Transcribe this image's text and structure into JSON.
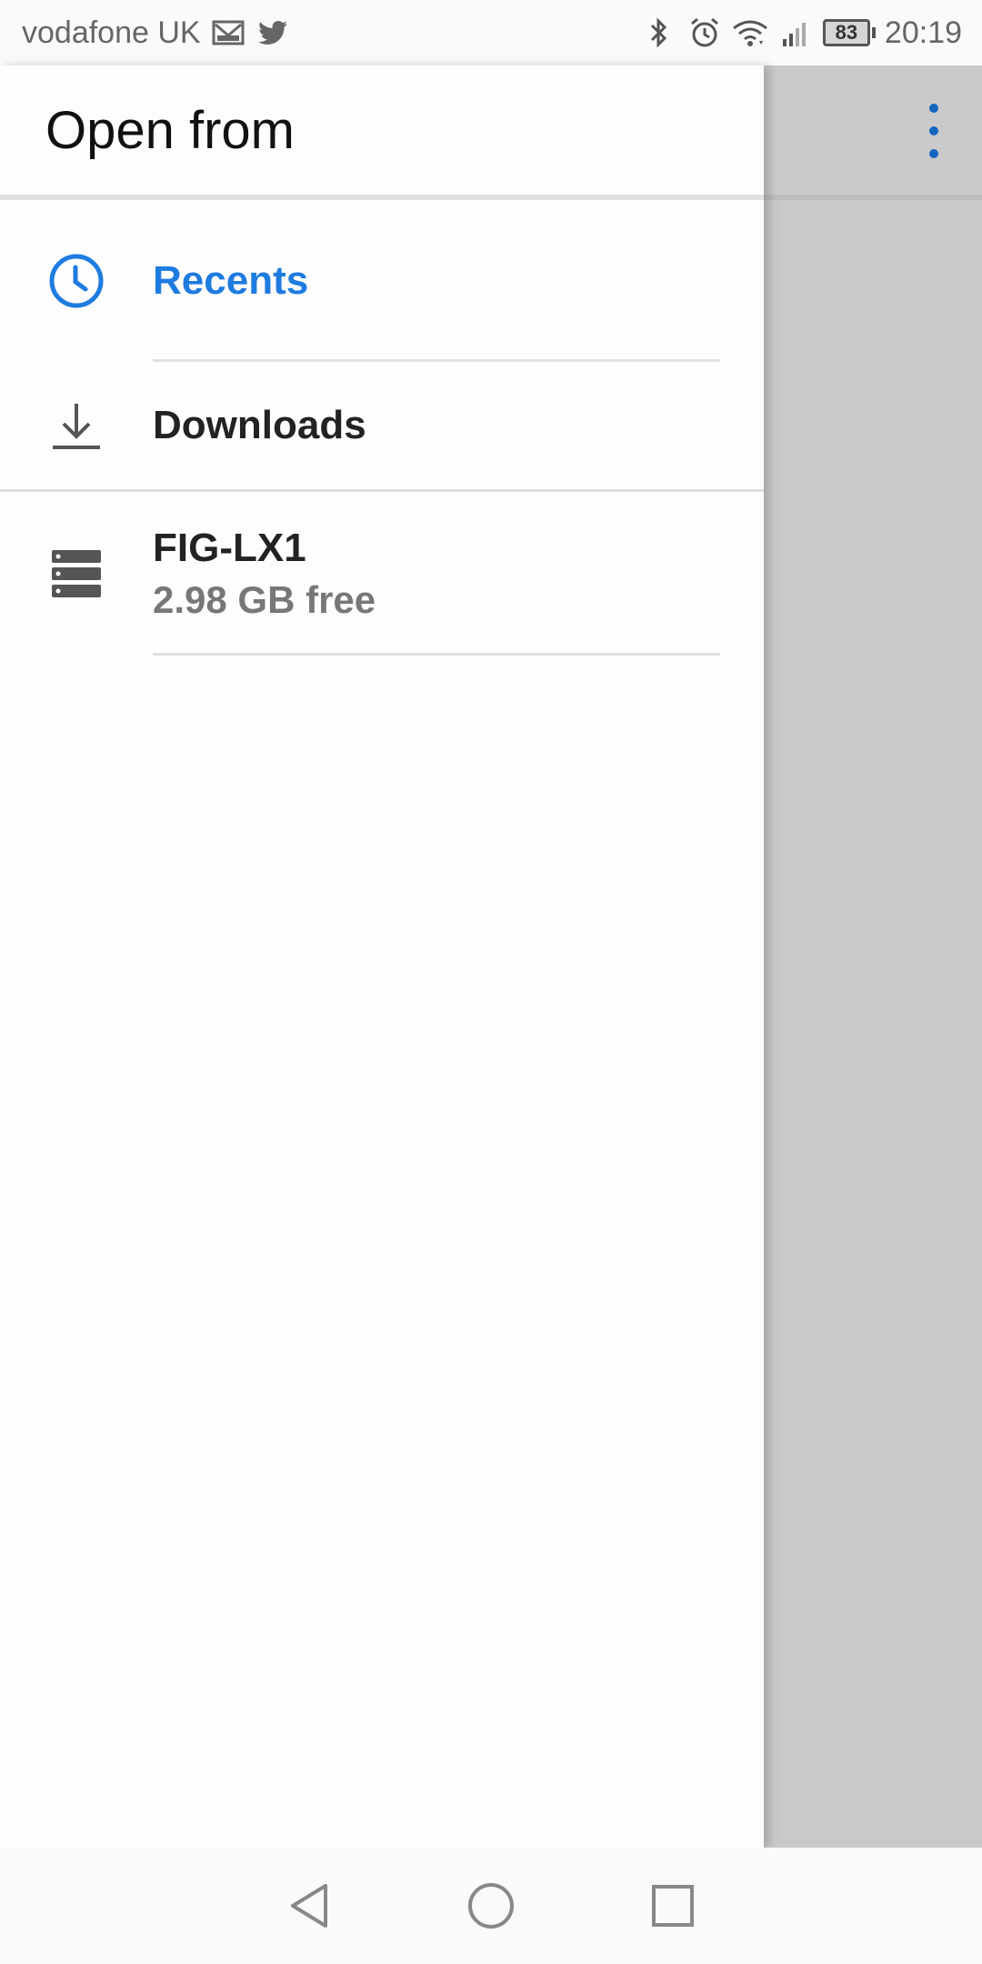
{
  "status_bar": {
    "carrier": "vodafone UK",
    "battery_level": "83",
    "time": "20:19",
    "icons": [
      "gmail-icon",
      "twitter-icon",
      "bluetooth-icon",
      "alarm-icon",
      "wifi-icon",
      "signal-icon",
      "battery-icon"
    ]
  },
  "drawer": {
    "title": "Open from",
    "items": [
      {
        "label": "Recents",
        "icon": "clock-icon",
        "active": true
      },
      {
        "label": "Downloads",
        "icon": "download-icon",
        "active": false
      },
      {
        "label": "FIG-LX1",
        "sublabel": "2.98 GB free",
        "icon": "storage-icon",
        "active": false
      }
    ]
  },
  "colors": {
    "accent": "#1e7be0",
    "overflow_menu": "#1565c0"
  },
  "nav_bar": {
    "icons": [
      "back-icon",
      "home-icon",
      "recents-square-icon"
    ]
  }
}
